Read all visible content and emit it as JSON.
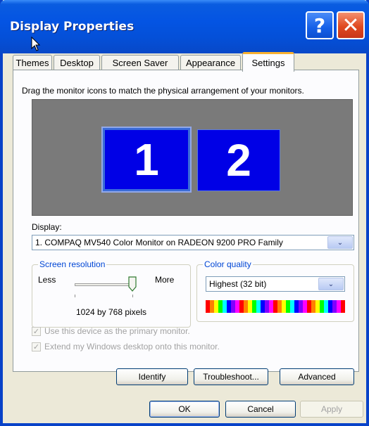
{
  "window": {
    "title": "Display Properties"
  },
  "tabs": [
    {
      "label": "Themes"
    },
    {
      "label": "Desktop"
    },
    {
      "label": "Screen Saver"
    },
    {
      "label": "Appearance"
    },
    {
      "label": "Settings",
      "active": true
    }
  ],
  "settings": {
    "instruction": "Drag the monitor icons to match the physical arrangement of your monitors.",
    "monitors": [
      "1",
      "2"
    ],
    "display_label": "Display:",
    "display_value": "1. COMPAQ MV540 Color Monitor on RADEON 9200 PRO Family",
    "resolution": {
      "title": "Screen resolution",
      "less": "Less",
      "more": "More",
      "value": "1024 by 768 pixels"
    },
    "color": {
      "title": "Color quality",
      "value": "Highest (32 bit)"
    },
    "primary_check": "Use this device as the primary monitor.",
    "extend_check": "Extend my Windows desktop onto this monitor."
  },
  "buttons": {
    "identify": "Identify",
    "troubleshoot": "Troubleshoot...",
    "advanced": "Advanced",
    "ok": "OK",
    "cancel": "Cancel",
    "apply": "Apply"
  },
  "icons": {
    "help": "?",
    "close": "✕",
    "dropdown": "⌄",
    "check": "✓"
  },
  "colors": {
    "title_blue": "#0454e3",
    "monitor_blue": "#0000e6",
    "group_title": "#0046d5"
  }
}
